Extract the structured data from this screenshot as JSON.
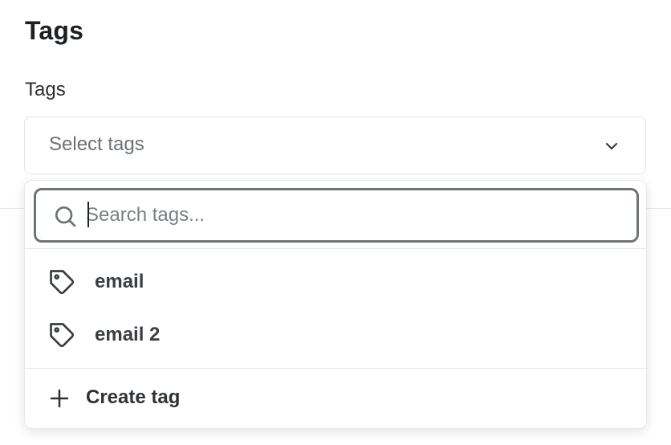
{
  "section": {
    "title": "Tags"
  },
  "field": {
    "label": "Tags",
    "placeholder": "Select tags",
    "chevron_icon": "chevron-down-icon"
  },
  "dropdown": {
    "search": {
      "placeholder": "Search tags...",
      "value": "",
      "icon": "search-icon"
    },
    "options": [
      {
        "label": "email",
        "icon": "tag-icon"
      },
      {
        "label": "email 2",
        "icon": "tag-icon"
      }
    ],
    "create": {
      "label": "Create tag",
      "icon": "plus-icon"
    }
  }
}
